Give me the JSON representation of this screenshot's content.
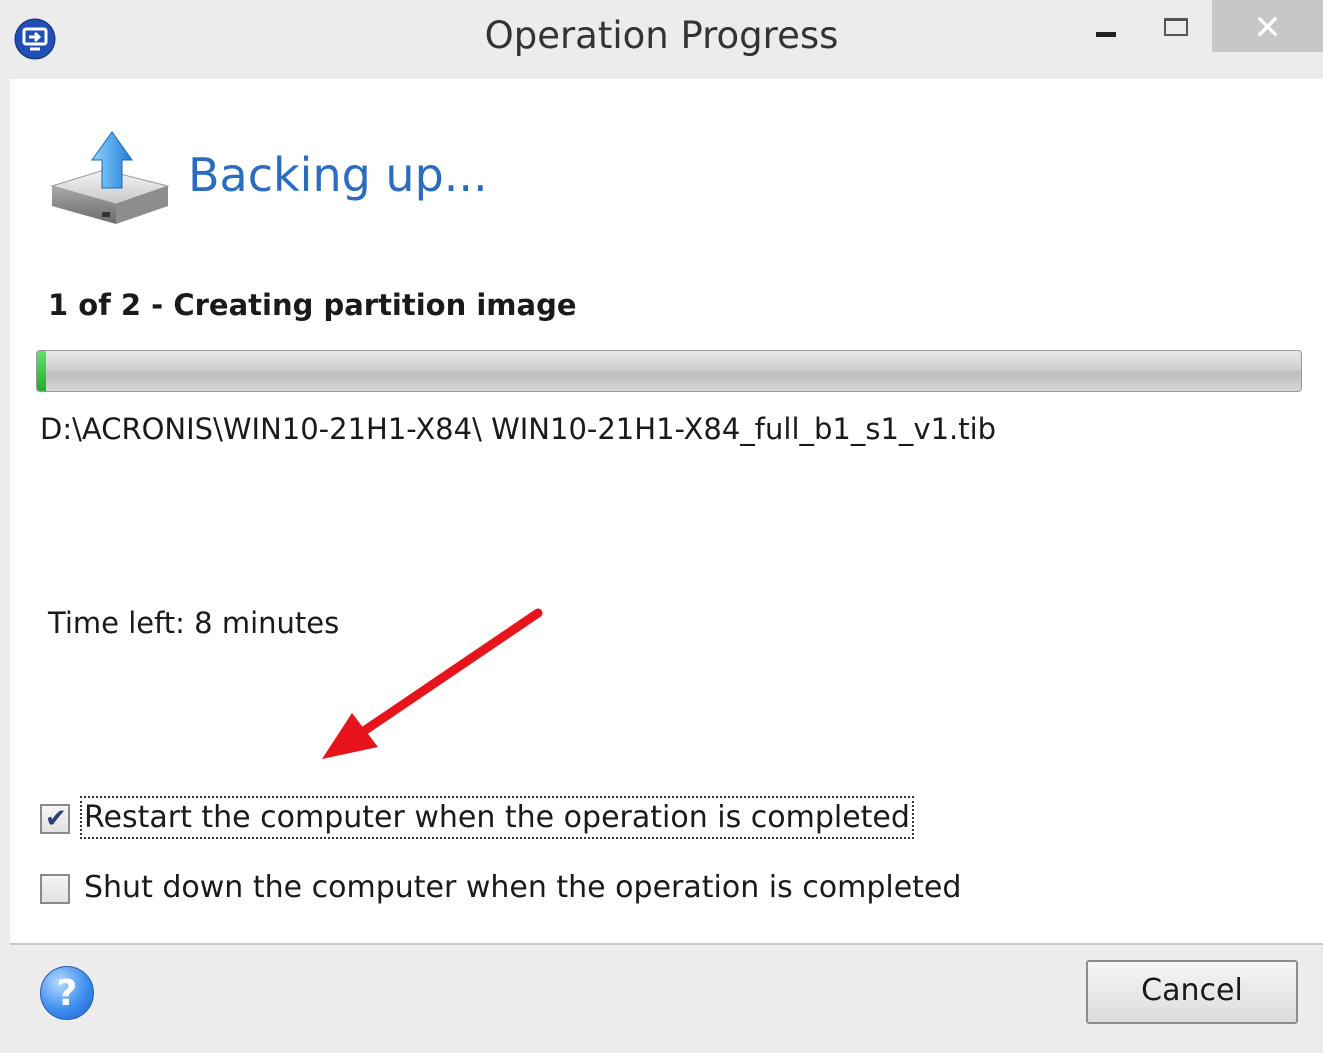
{
  "window": {
    "title": "Operation Progress"
  },
  "titlebar": {
    "close_glyph": "✕"
  },
  "main": {
    "heading": "Backing up...",
    "step_text": "1 of 2 - Creating partition image",
    "progress_fraction": 0.007,
    "file_path": "D:\\ACRONIS\\WIN10-21H1-X84\\ WIN10-21H1-X84_full_b1_s1_v1.tib",
    "time_left": "Time left: 8 minutes"
  },
  "options": {
    "restart_label": "Restart the computer when the operation is completed",
    "restart_checked": true,
    "shutdown_label": "Shut down the computer when the operation is completed",
    "shutdown_checked": false
  },
  "footer": {
    "help_glyph": "?",
    "cancel_label": "Cancel"
  },
  "colors": {
    "accent": "#2a6cbf",
    "progress": "#2fbf3a",
    "annotation_arrow": "#e8141b"
  },
  "icons": [
    "app-icon",
    "drive-backup-icon",
    "help-icon",
    "checkmark-icon",
    "annotation-arrow-icon"
  ]
}
